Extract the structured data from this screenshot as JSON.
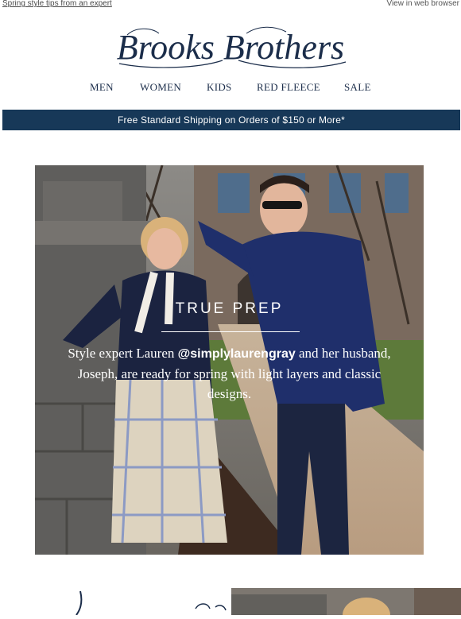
{
  "preheader": {
    "left_link": "Spring style tips from an expert",
    "right_link": "View in web browser"
  },
  "brand": {
    "name": "Brooks Brothers",
    "color": "#1b2d4a"
  },
  "nav": {
    "items": [
      "MEN",
      "WOMEN",
      "KIDS",
      "RED FLEECE",
      "SALE"
    ]
  },
  "shipping_banner": {
    "text": "Free Standard Shipping on Orders of $150 or More*",
    "background": "#173858"
  },
  "hero": {
    "title": "TRUE PREP",
    "copy_before": "Style expert Lauren ",
    "handle": "@simplylaurengray",
    "copy_after": " and her husband, Joseph, are ready for spring with light layers and classic designs."
  }
}
